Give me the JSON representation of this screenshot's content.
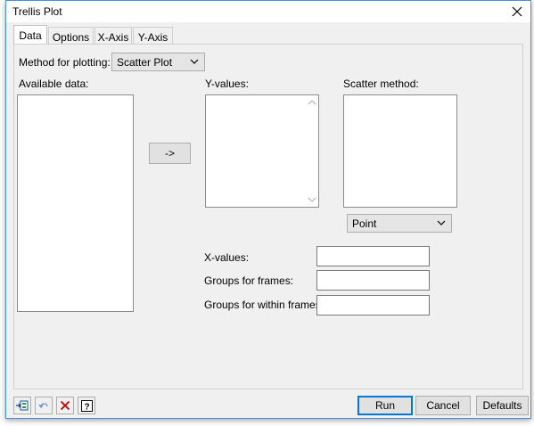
{
  "window": {
    "title": "Trellis Plot"
  },
  "tabs": [
    {
      "label": "Data"
    },
    {
      "label": "Options"
    },
    {
      "label": "X-Axis"
    },
    {
      "label": "Y-Axis"
    }
  ],
  "method": {
    "label": "Method for plotting:",
    "selected": "Scatter Plot"
  },
  "available_data": {
    "label": "Available data:"
  },
  "move_button": {
    "label": "->"
  },
  "y_values": {
    "label": "Y-values:"
  },
  "scatter_method": {
    "label": "Scatter method:",
    "selected": "Point"
  },
  "fields": {
    "x_values": {
      "label": "X-values:",
      "value": ""
    },
    "groups_frames": {
      "label": "Groups for frames:",
      "value": ""
    },
    "groups_within": {
      "label": "Groups for within frames:",
      "value": ""
    }
  },
  "footer": {
    "run": "Run",
    "cancel": "Cancel",
    "defaults": "Defaults"
  },
  "icons": {
    "pin": "pin-to-spreadsheet-icon",
    "undo": "undo-icon",
    "clear": "clear-x-icon",
    "help": "help-icon"
  },
  "colors": {
    "accent": "#0078d7",
    "window_bg": "#f0f0f0",
    "clear_red": "#c00000"
  }
}
